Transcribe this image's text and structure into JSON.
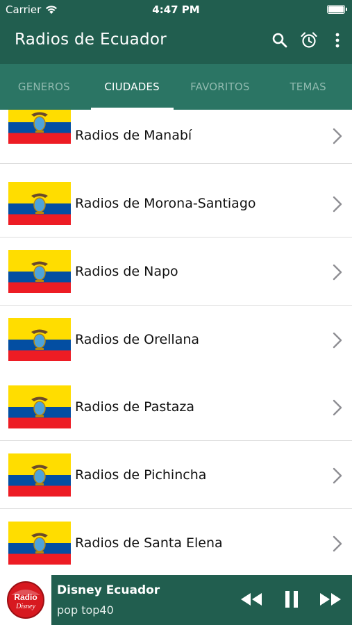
{
  "status_bar": {
    "carrier": "Carrier",
    "time": "4:47 PM"
  },
  "app": {
    "title": "Radios de Ecuador"
  },
  "toolbar": {
    "icons": [
      "search-icon",
      "alarm-clock-icon",
      "more-vert-icon"
    ]
  },
  "tabs": [
    {
      "label": "GENEROS",
      "active": false
    },
    {
      "label": "CIUDADES",
      "active": true
    },
    {
      "label": "FAVORITOS",
      "active": false
    },
    {
      "label": "TEMAS",
      "active": false
    }
  ],
  "list": {
    "items": [
      {
        "label": "Radios de Manabí"
      },
      {
        "label": "Radios de Morona-Santiago"
      },
      {
        "label": "Radios de Napo"
      },
      {
        "label": "Radios de Orellana"
      },
      {
        "label": "Radios de Pastaza"
      },
      {
        "label": "Radios de Pichincha"
      },
      {
        "label": "Radios de Santa Elena"
      }
    ]
  },
  "player": {
    "station": "Disney Ecuador",
    "subtitle": "pop top40",
    "logo_text": [
      "Radio",
      "Disney"
    ],
    "controls": [
      "rewind-icon",
      "pause-icon",
      "fast-forward-icon"
    ]
  },
  "colors": {
    "header": "#215e4f",
    "tabs": "#2b7564",
    "flag_yellow": "#ffdd00",
    "flag_blue": "#034ea2",
    "flag_red": "#ed1c24"
  }
}
